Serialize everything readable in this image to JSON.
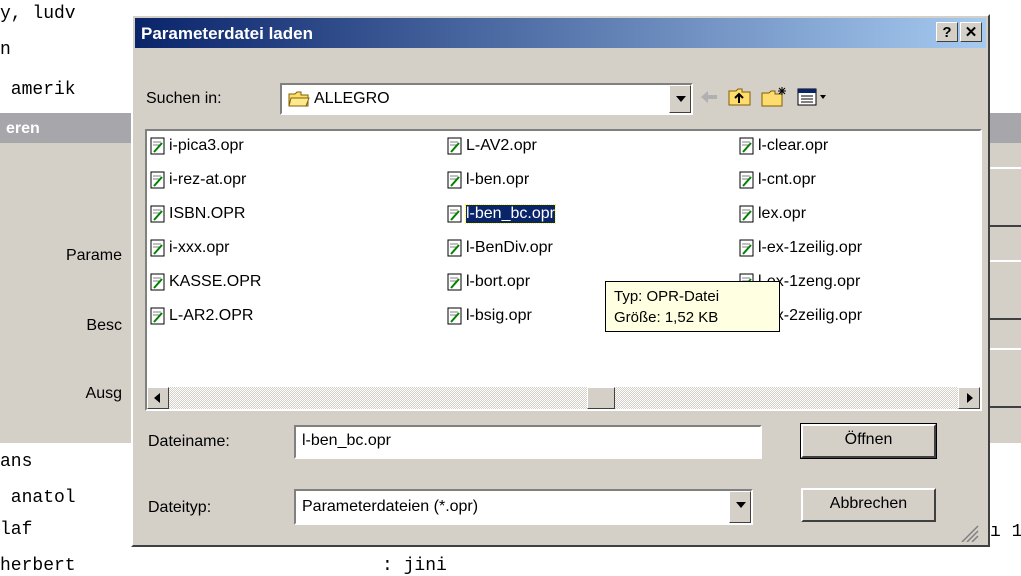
{
  "background_text": {
    "line1": "y, ludv",
    "line2": "n",
    "line3": " amerik",
    "line4": "ans",
    "line5": " anatol",
    "line6": "laf",
    "line7": "herbert",
    "line7b": ": jini",
    "right_fragment": "ı 1"
  },
  "background_dialog": {
    "title": "eren",
    "labels": [
      "Parame",
      "Besc",
      "Ausg"
    ]
  },
  "dialog": {
    "title": "Parameterdatei laden",
    "help_label": "?",
    "close_label": "✕",
    "look_in_label": "Suchen in:",
    "look_in_value": "ALLEGRO",
    "files": [
      {
        "name": "i-pica3.opr"
      },
      {
        "name": "i-rez-at.opr"
      },
      {
        "name": "ISBN.OPR"
      },
      {
        "name": "i-xxx.opr"
      },
      {
        "name": "KASSE.OPR"
      },
      {
        "name": "L-AR2.OPR"
      },
      {
        "name": "L-AV2.opr"
      },
      {
        "name": "l-ben.opr"
      },
      {
        "name": "l-ben_bc.opr"
      },
      {
        "name": "l-BenDiv.opr"
      },
      {
        "name": "l-bort.opr"
      },
      {
        "name": "l-bsig.opr"
      },
      {
        "name": "l-clear.opr"
      },
      {
        "name": "l-cnt.opr"
      },
      {
        "name": "lex.opr"
      },
      {
        "name": "l-ex-1zeilig.opr"
      },
      {
        "name": "l-ex-1zeng.opr"
      },
      {
        "name": "l-ex-2zeilig.opr"
      }
    ],
    "selected_file": "l-ben_bc.opr",
    "tooltip_line1": "Typ: OPR-Datei",
    "tooltip_line2": "Größe: 1,52 KB",
    "filename_label": "Dateiname:",
    "filename_value": "l-ben_bc.opr",
    "filetype_label": "Dateityp:",
    "filetype_value": "Parameterdateien (*.opr)",
    "open_button": "Öffnen",
    "cancel_button": "Abbrechen"
  },
  "colors": {
    "titlebar_start": "#0a246a",
    "titlebar_end": "#a6caf0",
    "face": "#d4d0c8",
    "selection": "#0a246a",
    "tooltip": "#ffffe1"
  }
}
